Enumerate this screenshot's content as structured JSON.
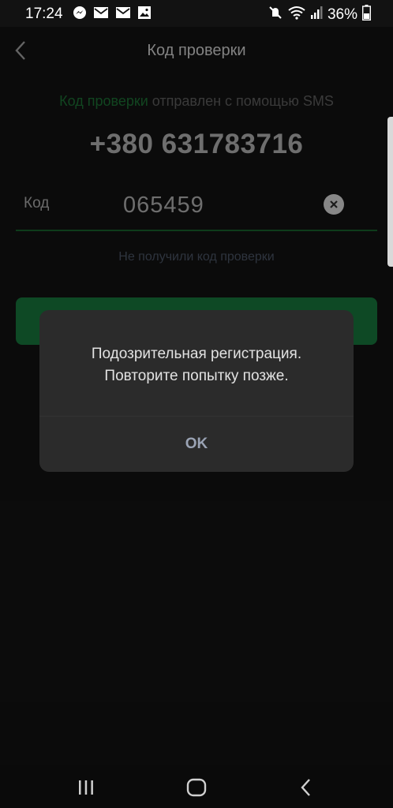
{
  "status_bar": {
    "time": "17:24",
    "battery_text": "36%",
    "notification_icons": [
      "messenger-icon",
      "mail-icon",
      "mail-icon",
      "image-icon"
    ],
    "system_icons": [
      "mute-icon",
      "wifi-icon",
      "signal-icon",
      "battery-icon"
    ]
  },
  "header": {
    "title": "Код проверки"
  },
  "verification": {
    "info_highlight": "Код проверки",
    "info_rest": " отправлен с помощью SMS",
    "phone_number": "+380 631783716",
    "code_label": "Код",
    "code_value": "065459",
    "resend_link": "Не получили код проверки"
  },
  "dialog": {
    "message_line1": "Подозрительная регистрация.",
    "message_line2": "Повторите попытку позже.",
    "ok_label": "OK"
  },
  "colors": {
    "accent_green": "#16703a",
    "highlight_green": "#1b6b32",
    "dialog_bg": "#2b2b2b"
  }
}
